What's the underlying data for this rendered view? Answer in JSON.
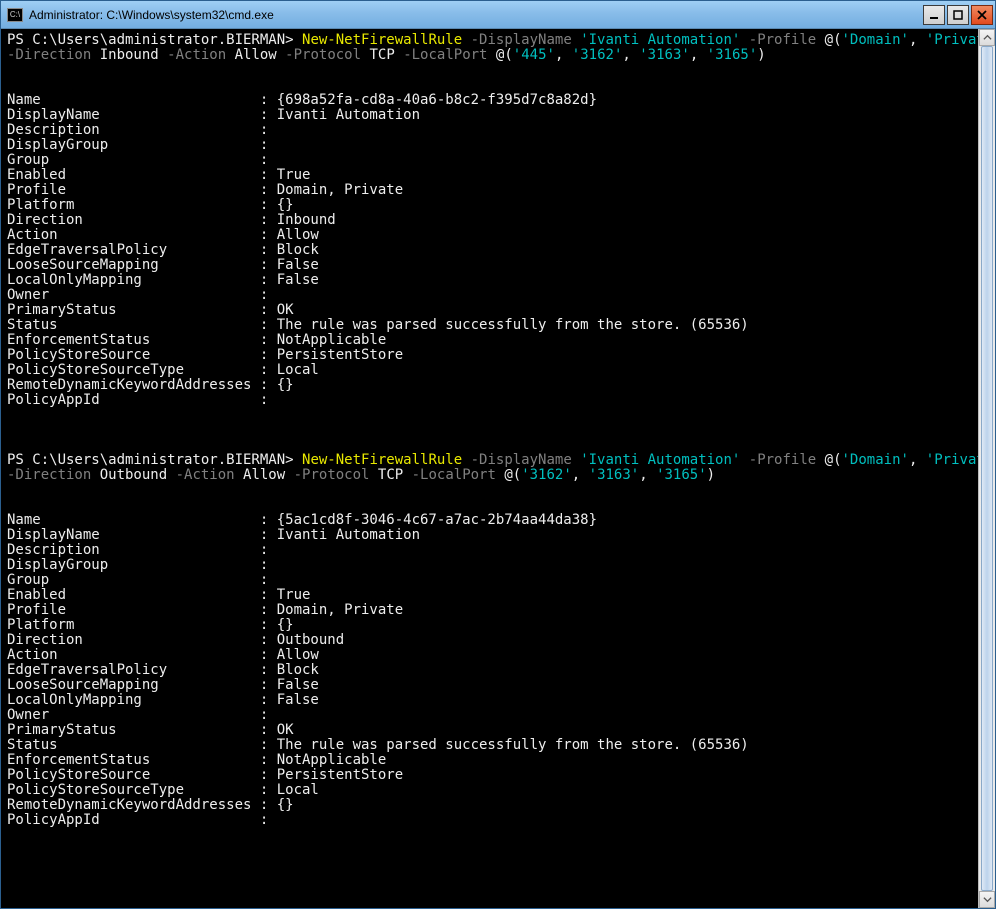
{
  "window": {
    "title": "Administrator: C:\\Windows\\system32\\cmd.exe",
    "icon_label": "cmd-icon"
  },
  "prompt": "PS C:\\Users\\administrator.BIERMAN> ",
  "cmd1": {
    "cmdlet": "New-NetFirewallRule",
    "p_displayname": " -DisplayName ",
    "v_displayname": "'Ivanti Automation'",
    "p_profile": " -Profile ",
    "at1": "@(",
    "v_profile1": "'Domain'",
    "comma": ", ",
    "v_profile2": "'Private'",
    "rparen": ")",
    "p_direction": "-Direction ",
    "v_direction": "Inbound",
    "p_action": " -Action ",
    "v_action": "Allow",
    "p_protocol": " -Protocol ",
    "v_protocol": "TCP",
    "p_localport": " -LocalPort ",
    "at2": "@(",
    "port1": "'445'",
    "port2": "'3162'",
    "port3": "'3163'",
    "port4": "'3165'",
    "rparen2": ")"
  },
  "cmd2": {
    "cmdlet": "New-NetFirewallRule",
    "p_displayname": " -DisplayName ",
    "v_displayname": "'Ivanti Automation'",
    "p_profile": " -Profile ",
    "at1": "@(",
    "v_profile1": "'Domain'",
    "comma": ", ",
    "v_profile2": "'Private'",
    "rparen": ")",
    "p_direction": "-Direction ",
    "v_direction": "Outbound",
    "p_action": " -Action ",
    "v_action": "Allow",
    "p_protocol": " -Protocol ",
    "v_protocol": "TCP",
    "p_localport": " -LocalPort ",
    "at2": "@(",
    "port1": "'3162'",
    "port2": "'3163'",
    "port3": "'3165'",
    "rparen2": ")"
  },
  "out1": [
    {
      "k": "Name",
      "v": "{698a52fa-cd8a-40a6-b8c2-f395d7c8a82d}"
    },
    {
      "k": "DisplayName",
      "v": "Ivanti Automation"
    },
    {
      "k": "Description",
      "v": ""
    },
    {
      "k": "DisplayGroup",
      "v": ""
    },
    {
      "k": "Group",
      "v": ""
    },
    {
      "k": "Enabled",
      "v": "True"
    },
    {
      "k": "Profile",
      "v": "Domain, Private"
    },
    {
      "k": "Platform",
      "v": "{}"
    },
    {
      "k": "Direction",
      "v": "Inbound"
    },
    {
      "k": "Action",
      "v": "Allow"
    },
    {
      "k": "EdgeTraversalPolicy",
      "v": "Block"
    },
    {
      "k": "LooseSourceMapping",
      "v": "False"
    },
    {
      "k": "LocalOnlyMapping",
      "v": "False"
    },
    {
      "k": "Owner",
      "v": ""
    },
    {
      "k": "PrimaryStatus",
      "v": "OK"
    },
    {
      "k": "Status",
      "v": "The rule was parsed successfully from the store. (65536)"
    },
    {
      "k": "EnforcementStatus",
      "v": "NotApplicable"
    },
    {
      "k": "PolicyStoreSource",
      "v": "PersistentStore"
    },
    {
      "k": "PolicyStoreSourceType",
      "v": "Local"
    },
    {
      "k": "RemoteDynamicKeywordAddresses",
      "v": "{}"
    },
    {
      "k": "PolicyAppId",
      "v": ""
    }
  ],
  "out2": [
    {
      "k": "Name",
      "v": "{5ac1cd8f-3046-4c67-a7ac-2b74aa44da38}"
    },
    {
      "k": "DisplayName",
      "v": "Ivanti Automation"
    },
    {
      "k": "Description",
      "v": ""
    },
    {
      "k": "DisplayGroup",
      "v": ""
    },
    {
      "k": "Group",
      "v": ""
    },
    {
      "k": "Enabled",
      "v": "True"
    },
    {
      "k": "Profile",
      "v": "Domain, Private"
    },
    {
      "k": "Platform",
      "v": "{}"
    },
    {
      "k": "Direction",
      "v": "Outbound"
    },
    {
      "k": "Action",
      "v": "Allow"
    },
    {
      "k": "EdgeTraversalPolicy",
      "v": "Block"
    },
    {
      "k": "LooseSourceMapping",
      "v": "False"
    },
    {
      "k": "LocalOnlyMapping",
      "v": "False"
    },
    {
      "k": "Owner",
      "v": ""
    },
    {
      "k": "PrimaryStatus",
      "v": "OK"
    },
    {
      "k": "Status",
      "v": "The rule was parsed successfully from the store. (65536)"
    },
    {
      "k": "EnforcementStatus",
      "v": "NotApplicable"
    },
    {
      "k": "PolicyStoreSource",
      "v": "PersistentStore"
    },
    {
      "k": "PolicyStoreSourceType",
      "v": "Local"
    },
    {
      "k": "RemoteDynamicKeywordAddresses",
      "v": "{}"
    },
    {
      "k": "PolicyAppId",
      "v": ""
    }
  ],
  "kv_width": 29
}
